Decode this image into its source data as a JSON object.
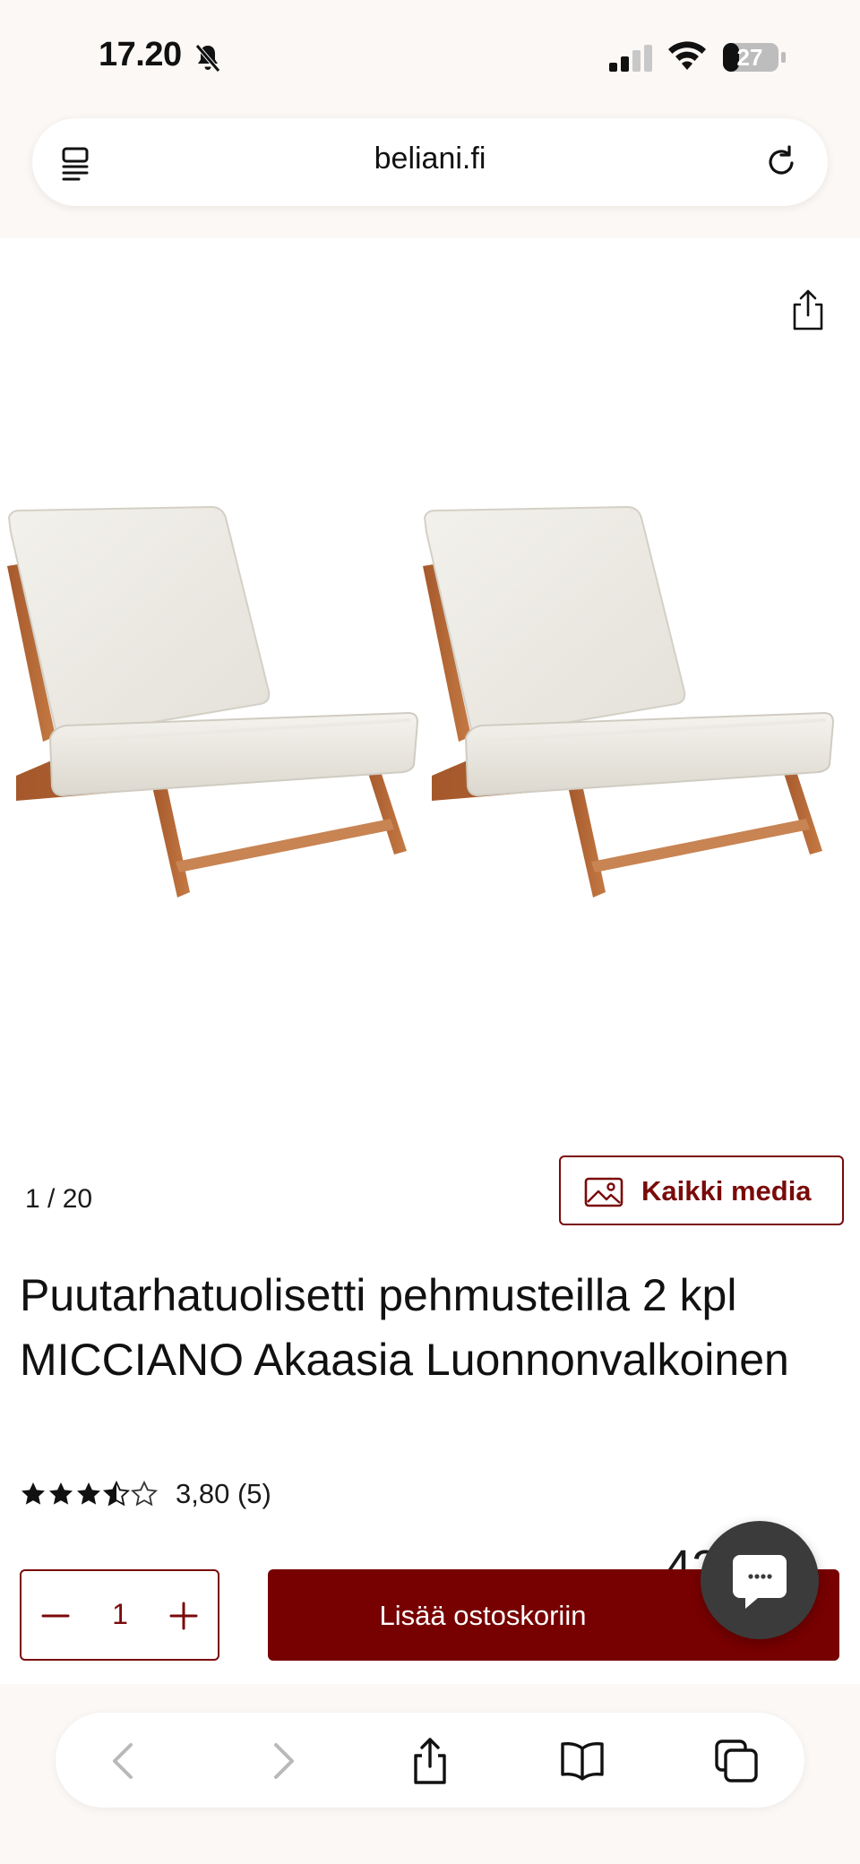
{
  "status_bar": {
    "time": "17.20",
    "battery": "27"
  },
  "browser": {
    "url": "beliani.fi"
  },
  "gallery": {
    "counter": "1 /  20",
    "all_media_label": "Kaikki media"
  },
  "product": {
    "title": "Puutarhatuolisetti pehmusteilla 2 kpl MICCIANO Akaasia Luonnonvalkoinen",
    "rating_text": "3,80 (5)",
    "rating_value": 3.8,
    "rating_max": 5,
    "price_partial": "42   €"
  },
  "purchase": {
    "quantity": "1",
    "add_to_cart_label": "Lisää ostoskoriin"
  },
  "colors": {
    "brand": "#770000",
    "brand_outline": "#7a0a0a",
    "chrome_background": "#fcf8f5"
  }
}
